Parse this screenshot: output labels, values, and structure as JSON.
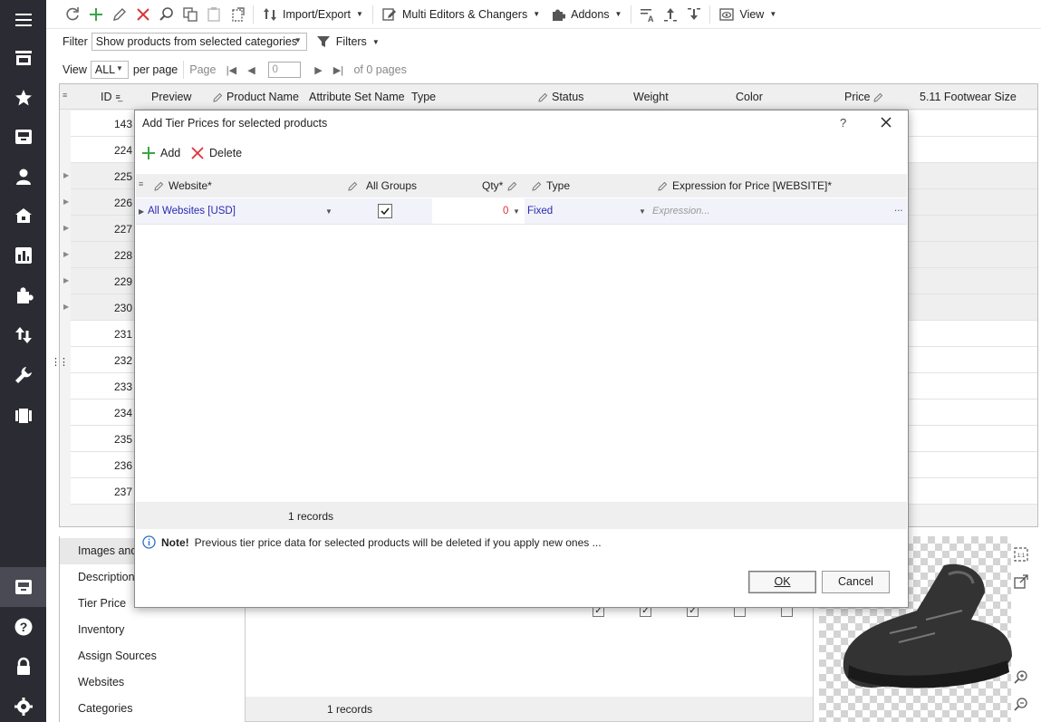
{
  "toolbar": {
    "import_export": "Import/Export",
    "multi_editors": "Multi Editors & Changers",
    "addons": "Addons",
    "view": "View"
  },
  "filter": {
    "label": "Filter",
    "value": "Show products from selected categories",
    "filters_label": "Filters"
  },
  "pager": {
    "view_label": "View",
    "view_value": "ALL",
    "per_page": "per page",
    "page_label": "Page",
    "page_value": "0",
    "of_pages": "of 0 pages"
  },
  "grid": {
    "columns": [
      "ID",
      "Preview",
      "Product Name",
      "Attribute Set Name",
      "Type",
      "Status",
      "Weight",
      "Color",
      "Price",
      "5.11 Footwear Size"
    ],
    "row_ids": [
      "143",
      "224",
      "225",
      "226",
      "227",
      "228",
      "229",
      "230",
      "231",
      "232",
      "233",
      "234",
      "235",
      "236",
      "237"
    ]
  },
  "bottom_tabs": [
    "Images and",
    "Description",
    "Tier Price",
    "Inventory",
    "Assign Sources",
    "Websites",
    "Categories"
  ],
  "bottom_grid": {
    "records": "1 records"
  },
  "modal": {
    "title": "Add Tier Prices for selected products",
    "help": "?",
    "add_label": "Add",
    "delete_label": "Delete",
    "columns": {
      "website": "Website*",
      "groups": "All Groups",
      "qty": "Qty*",
      "type": "Type",
      "expression": "Expression for Price [WEBSITE]*"
    },
    "row": {
      "website": "All Websites [USD]",
      "groups_checked": true,
      "qty": "0",
      "type": "Fixed",
      "expression_placeholder": "Expression...",
      "ellipsis": "..."
    },
    "records": "1 records",
    "note_bold": "Note!",
    "note_text": "Previous tier price data for selected products will be deleted if you apply new ones ...",
    "ok_label": "OK",
    "cancel_label": "Cancel"
  },
  "colors": {
    "sidebar": "#2b2b33",
    "link": "#2a2ab0",
    "add_green": "#3aa545",
    "delete_red": "#d9343a",
    "info_blue": "#2c6fc9"
  }
}
